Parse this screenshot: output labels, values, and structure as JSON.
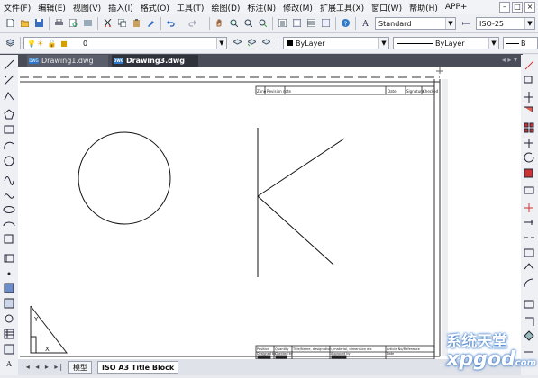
{
  "menu": [
    "文件(F)",
    "编辑(E)",
    "视图(V)",
    "插入(I)",
    "格式(O)",
    "工具(T)",
    "绘图(D)",
    "标注(N)",
    "修改(M)",
    "扩展工具(X)",
    "窗口(W)",
    "帮助(H)",
    "APP+"
  ],
  "window_buttons": [
    "–",
    "□",
    "×"
  ],
  "toolbar1": {
    "text_style": "Standard",
    "dim_style": "ISO-25"
  },
  "toolbar2": {
    "layer_value": "0",
    "color_value": "ByLayer",
    "linetype_value": "ByLayer",
    "lineweight_value": "B"
  },
  "tabs": [
    {
      "icon_text": "DWG",
      "label": "Drawing1.dwg",
      "active": false
    },
    {
      "icon_text": "DWG",
      "label": "Drawing3.dwg",
      "active": true
    }
  ],
  "title_block": {
    "top_row": [
      "Zone",
      "Revision note",
      "Date",
      "Signature",
      "Checked"
    ],
    "bottom_row": [
      "Position",
      "Quantity",
      "Title/Name, designation, material, dimension etc",
      "Article No/Reference"
    ],
    "bottom_row2": [
      "Designed by",
      "Checked by",
      "Approved by",
      "Date"
    ]
  },
  "ucs": {
    "x": "X",
    "y": "Y"
  },
  "layout_tabs": [
    "模型",
    "ISO A3 Title Block"
  ],
  "watermark": {
    "line1": "系统天堂",
    "line2": "xpgod",
    "line3": "com"
  },
  "colors": {
    "accent": "#2f78c8",
    "tab_bar": "#4a4d58"
  }
}
